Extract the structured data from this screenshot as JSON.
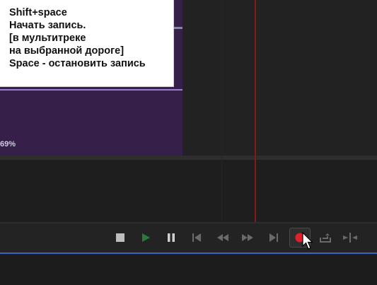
{
  "note": {
    "lines": [
      "Shift+space",
      "Начать запись.",
      "[в мультитреке",
      "на выбранной дороге]",
      "Space - остановить запись"
    ]
  },
  "clip": {
    "percent_label": "69%"
  },
  "transport": {
    "buttons": [
      {
        "name": "stop-button",
        "icon": "stop-icon"
      },
      {
        "name": "play-button",
        "icon": "play-icon"
      },
      {
        "name": "pause-button",
        "icon": "pause-icon"
      },
      {
        "name": "skip-to-start-button",
        "icon": "skip-start-icon"
      },
      {
        "name": "rewind-button",
        "icon": "rewind-icon"
      },
      {
        "name": "fast-forward-button",
        "icon": "fast-forward-icon"
      },
      {
        "name": "skip-to-end-button",
        "icon": "skip-end-icon"
      },
      {
        "name": "record-button",
        "icon": "record-icon"
      },
      {
        "name": "loop-button",
        "icon": "loop-icon"
      },
      {
        "name": "skip-selection-button",
        "icon": "skip-selection-icon"
      }
    ]
  },
  "colors": {
    "clip": "#362049",
    "playhead": "#8a1717",
    "record": "#e0202c",
    "play": "#2a7a3a",
    "progress": "#3d63c4"
  }
}
